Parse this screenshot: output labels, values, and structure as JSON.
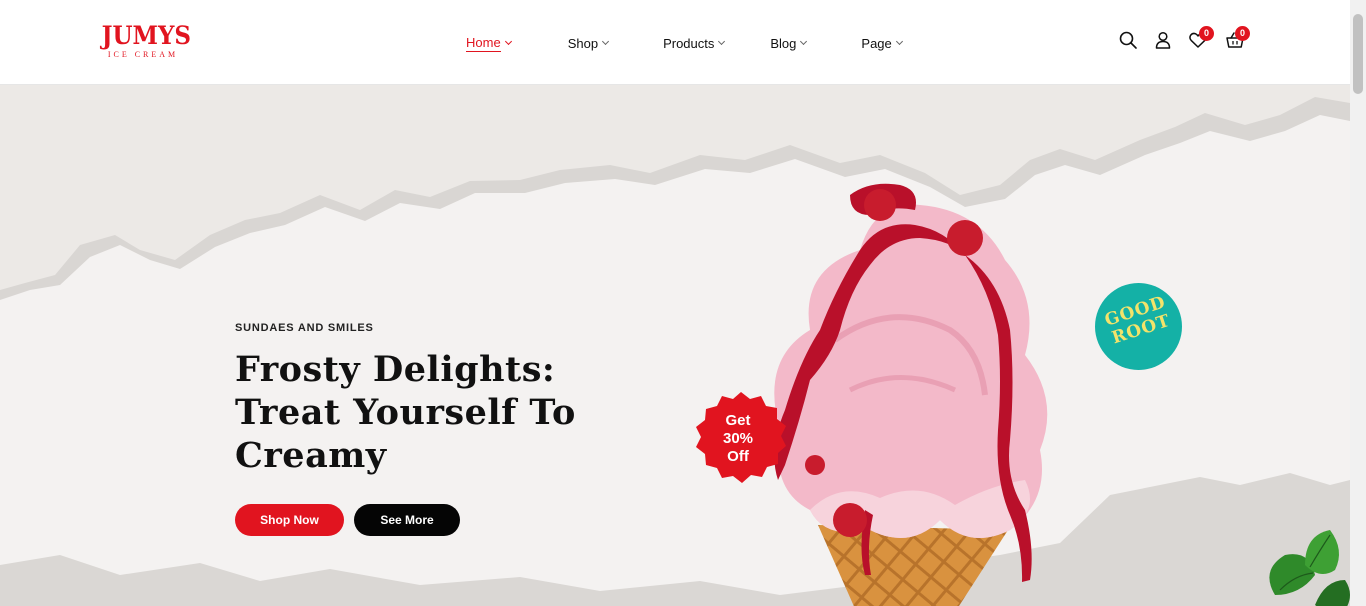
{
  "brand": {
    "name": "JUMYS",
    "subtitle": "ICE CREAM",
    "accent": "#e1141f"
  },
  "nav": {
    "items": [
      {
        "label": "Home",
        "active": true
      },
      {
        "label": "Shop",
        "active": false
      },
      {
        "label": "Products",
        "active": false
      },
      {
        "label": "Blog",
        "active": false
      },
      {
        "label": "Page",
        "active": false
      }
    ]
  },
  "header_icons": {
    "search": "search-icon",
    "account": "user-icon",
    "wishlist": {
      "icon": "heart-icon",
      "count": "0"
    },
    "cart": {
      "icon": "basket-icon",
      "count": "0"
    }
  },
  "hero": {
    "eyebrow": "SUNDAES AND SMILES",
    "headline_line1": "Frosty Delights:",
    "headline_line2": "Treat Yourself To",
    "headline_line3": "Creamy",
    "shop_button": "Shop Now",
    "more_button": "See More",
    "promo_line1": "Get",
    "promo_line2": "30%",
    "promo_line3": "Off",
    "badge_line1": "GOOD",
    "badge_line2": "ROOT",
    "colors": {
      "background": "#ece9e6",
      "promo": "#e1141f",
      "badge": "#14b1a6",
      "badge_text": "#f3e36a"
    }
  }
}
